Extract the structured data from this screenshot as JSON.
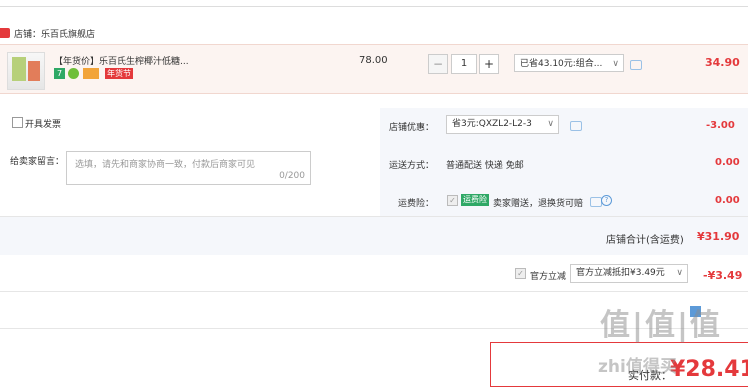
{
  "shop": {
    "name": "店铺：乐百氏旗舰店",
    "tag_color": "#e4393c"
  },
  "item": {
    "title": "【年货价】乐百氏生榨椰汁低糖...",
    "tags": [
      "7",
      "",
      "",
      "年货节"
    ],
    "unit_price": "78.00",
    "quantity": "1",
    "minus": "−",
    "plus": "+",
    "promotion": "已省43.10元:组合...",
    "subtotal": "34.90"
  },
  "invoice": {
    "label": "开具发票"
  },
  "message": {
    "label": "给卖家留言：",
    "placeholder": "选填，请先和商家协商一致，付款后商家可见",
    "count": "0/200"
  },
  "discount": {
    "label": "店铺优惠：",
    "value": "省3元:QXZL2-L2-3",
    "amount": "-3.00"
  },
  "shipping": {
    "label": "运送方式：",
    "value": "普通配送 快递 免邮",
    "amount": "0.00"
  },
  "insurance": {
    "label": "运费险：",
    "badge": "运费险",
    "text": "卖家赠送，退换货可赔",
    "amount": "0.00"
  },
  "shop_total": {
    "label": "店铺合计(含运费)",
    "amount": "¥31.90"
  },
  "platform_discount": {
    "label": "官方立减",
    "select": "官方立减抵扣¥3.49元",
    "amount": "-¥3.49"
  },
  "footer": {
    "partial_label": "实付款：",
    "partial_price": "¥28.41"
  },
  "watermark": {
    "line1": "值|值|值",
    "line2": "zhi值得买"
  },
  "colors": {
    "accent": "#e4393c",
    "panel_bg": "#f5f7fb",
    "item_bg": "#fcf4f1"
  }
}
